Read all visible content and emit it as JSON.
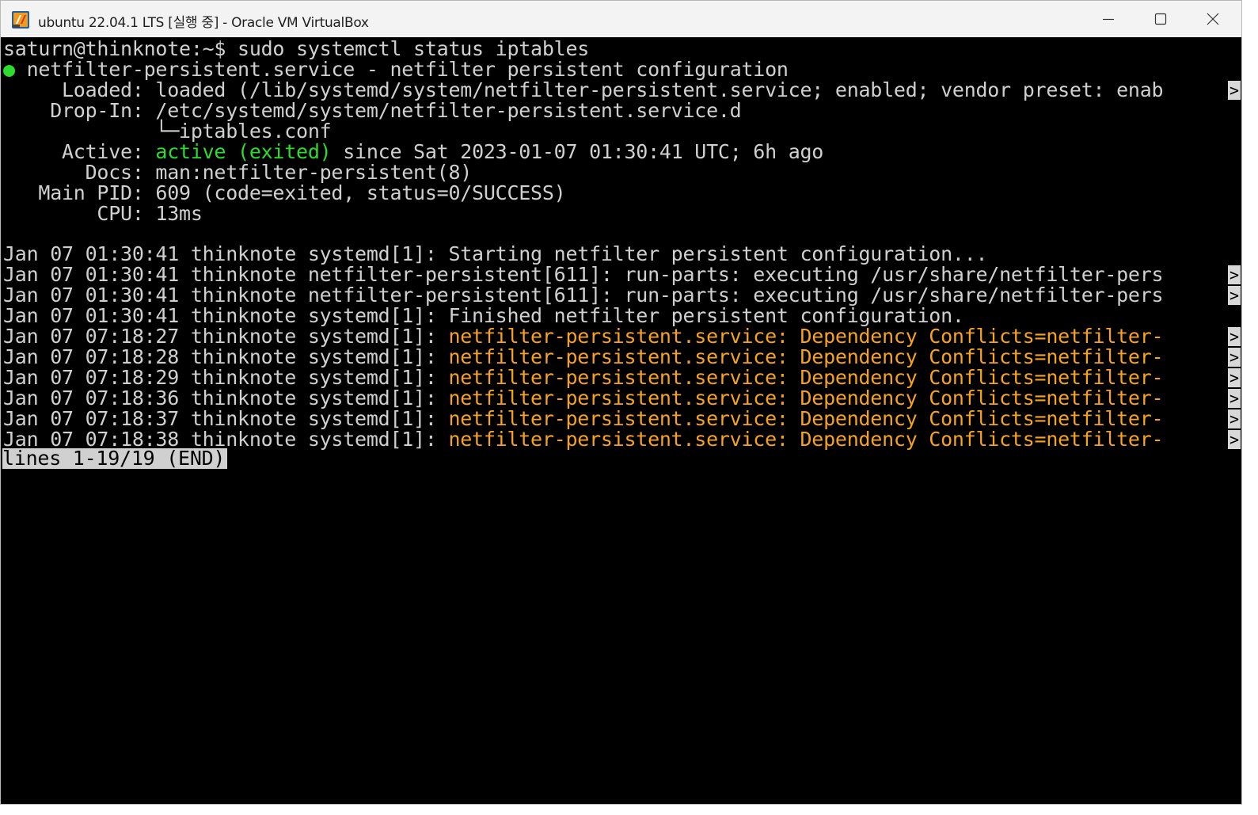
{
  "window": {
    "title": "ubuntu 22.04.1 LTS [실행 중] - Oracle VM VirtualBox",
    "icon": "virtualbox-icon",
    "controls": [
      "minimize-icon",
      "maximize-icon",
      "close-icon"
    ]
  },
  "terminal": {
    "prompt": "saturn@thinknote:~$ sudo systemctl status iptables",
    "unit_dot": "●",
    "unit_line": " netfilter-persistent.service - netfilter persistent configuration",
    "loaded": "     Loaded: loaded (/lib/systemd/system/netfilter-persistent.service; enabled; vendor preset: enab",
    "dropin": "    Drop-In: /etc/systemd/system/netfilter-persistent.service.d",
    "dropin_file": "             └─iptables.conf",
    "active_label": "     Active: ",
    "active_state": "active (exited)",
    "active_rest": " since Sat 2023-01-07 01:30:41 UTC; 6h ago",
    "docs": "       Docs: man:netfilter-persistent(8)",
    "main_pid": "   Main PID: 609 (code=exited, status=0/SUCCESS)",
    "cpu": "        CPU: 13ms",
    "logs": [
      {
        "prefix": "Jan 07 01:30:41 thinknote systemd[1]: ",
        "msg": "Starting netfilter persistent configuration...",
        "style": "normal",
        "truncated": false
      },
      {
        "prefix": "Jan 07 01:30:41 thinknote netfilter-persistent[611]: ",
        "msg": "run-parts: executing /usr/share/netfilter-pers",
        "style": "normal",
        "truncated": true
      },
      {
        "prefix": "Jan 07 01:30:41 thinknote netfilter-persistent[611]: ",
        "msg": "run-parts: executing /usr/share/netfilter-pers",
        "style": "normal",
        "truncated": true
      },
      {
        "prefix": "Jan 07 01:30:41 thinknote systemd[1]: ",
        "msg": "Finished netfilter persistent configuration.",
        "style": "normal",
        "truncated": false
      },
      {
        "prefix": "Jan 07 07:18:27 thinknote systemd[1]: ",
        "msg": "netfilter-persistent.service: Dependency Conflicts=netfilter-",
        "style": "warning",
        "truncated": true
      },
      {
        "prefix": "Jan 07 07:18:28 thinknote systemd[1]: ",
        "msg": "netfilter-persistent.service: Dependency Conflicts=netfilter-",
        "style": "warning",
        "truncated": true
      },
      {
        "prefix": "Jan 07 07:18:29 thinknote systemd[1]: ",
        "msg": "netfilter-persistent.service: Dependency Conflicts=netfilter-",
        "style": "warning",
        "truncated": true
      },
      {
        "prefix": "Jan 07 07:18:36 thinknote systemd[1]: ",
        "msg": "netfilter-persistent.service: Dependency Conflicts=netfilter-",
        "style": "warning",
        "truncated": true
      },
      {
        "prefix": "Jan 07 07:18:37 thinknote systemd[1]: ",
        "msg": "netfilter-persistent.service: Dependency Conflicts=netfilter-",
        "style": "warning",
        "truncated": true
      },
      {
        "prefix": "Jan 07 07:18:38 thinknote systemd[1]: ",
        "msg": "netfilter-persistent.service: Dependency Conflicts=netfilter-",
        "style": "warning",
        "truncated": true
      }
    ],
    "pager_status": "lines 1-19/19 (END)",
    "truncation_marker": ">"
  },
  "colors": {
    "background": "#000000",
    "text": "#d0d0d0",
    "active_green": "#2ddc2d",
    "warning_amber": "#f7a31c"
  }
}
